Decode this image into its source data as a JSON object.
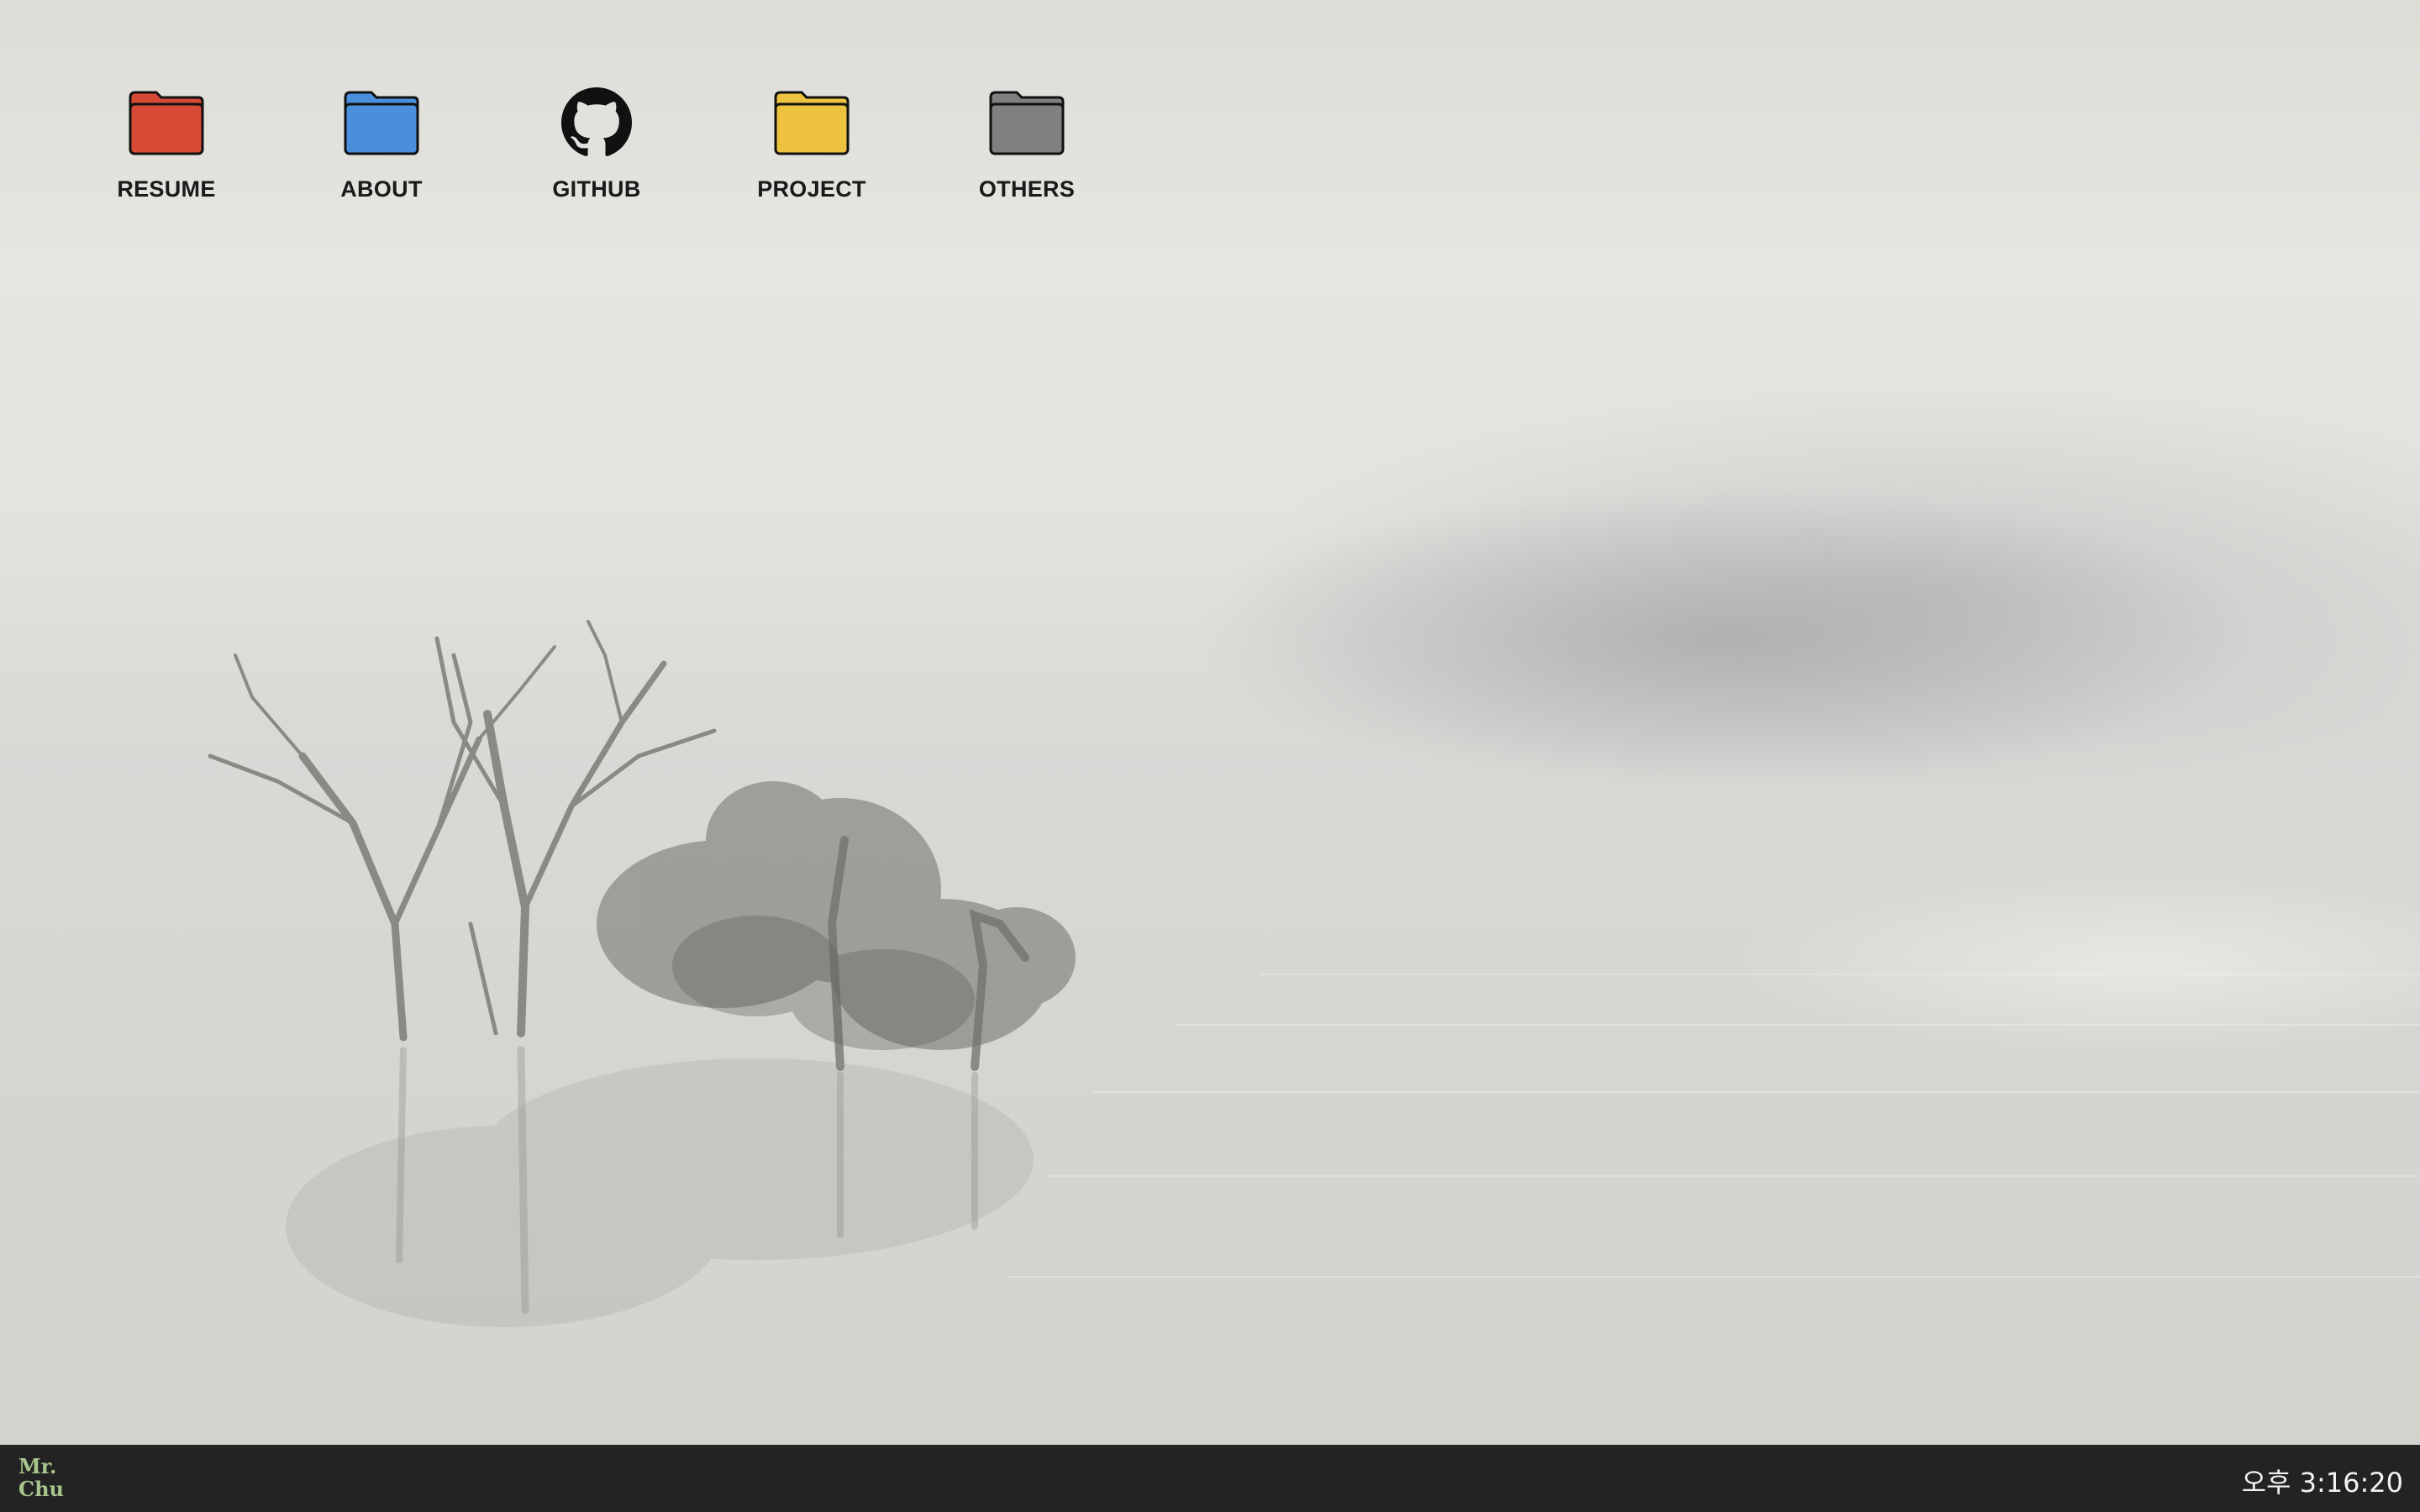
{
  "desktop": {
    "icons": [
      {
        "label": "RESUME",
        "icon": "folder-icon",
        "color": "#d64a36"
      },
      {
        "label": "ABOUT",
        "icon": "folder-icon",
        "color": "#4a8fdb"
      },
      {
        "label": "GITHUB",
        "icon": "github-icon",
        "color": "#111111"
      },
      {
        "label": "PROJECT",
        "icon": "folder-icon",
        "color": "#ecc23f"
      },
      {
        "label": "OTHERS",
        "icon": "folder-icon",
        "color": "#808080"
      }
    ]
  },
  "taskbar": {
    "logo_line1": "Mr.",
    "logo_line2": "Chu",
    "clock": "오후 3:16:20",
    "background": "#232323"
  }
}
